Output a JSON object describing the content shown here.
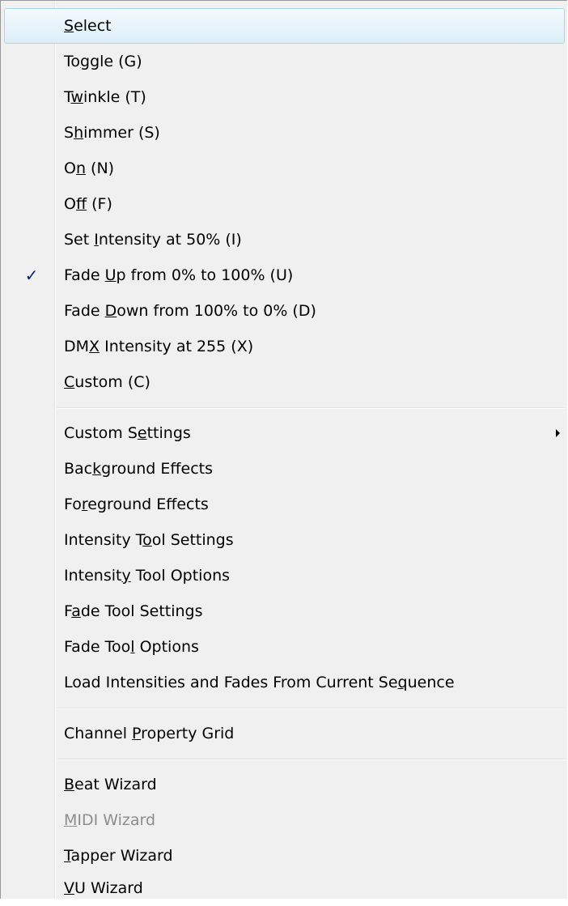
{
  "menu": {
    "items": [
      {
        "label": "Select",
        "mnemonic": "S"
      },
      {
        "label": "Toggle (G)",
        "mnemonic": "g"
      },
      {
        "label": "Twinkle (T)",
        "mnemonic": "w"
      },
      {
        "label": "Shimmer (S)",
        "mnemonic": "h"
      },
      {
        "label": "On (N)",
        "mnemonic": "n"
      },
      {
        "label": "Off (F)",
        "mnemonic": "f"
      },
      {
        "label": "Set Intensity at 50% (I)",
        "mnemonic": "I"
      },
      {
        "label": "Fade Up from 0% to 100% (U)",
        "mnemonic": "U",
        "checked": true
      },
      {
        "label": "Fade Down from 100% to 0% (D)",
        "mnemonic": "D"
      },
      {
        "label": "DMX Intensity at 255 (X)",
        "mnemonic": "X"
      },
      {
        "label": "Custom (C)",
        "mnemonic": "C"
      },
      {
        "label": "Custom Settings",
        "mnemonic": "e",
        "submenu": true
      },
      {
        "label": "Background Effects",
        "mnemonic": "k"
      },
      {
        "label": "Foreground Effects",
        "mnemonic": "r"
      },
      {
        "label": "Intensity Tool Settings",
        "mnemonic": "o"
      },
      {
        "label": "Intensity Tool Options",
        "mnemonic": "y"
      },
      {
        "label": "Fade Tool Settings",
        "mnemonic": "a"
      },
      {
        "label": "Fade Tool Options",
        "mnemonic": "l"
      },
      {
        "label": "Load Intensities and Fades From Current Sequence",
        "mnemonic": "q"
      },
      {
        "label": "Channel Property Grid",
        "mnemonic": "P"
      },
      {
        "label": "Beat Wizard",
        "mnemonic": "B"
      },
      {
        "label": "MIDI Wizard",
        "mnemonic": "M",
        "disabled": true
      },
      {
        "label": "Tapper Wizard",
        "mnemonic": "T"
      },
      {
        "label": "VU Wizard",
        "mnemonic": "V"
      }
    ],
    "check_glyph": "✓"
  }
}
